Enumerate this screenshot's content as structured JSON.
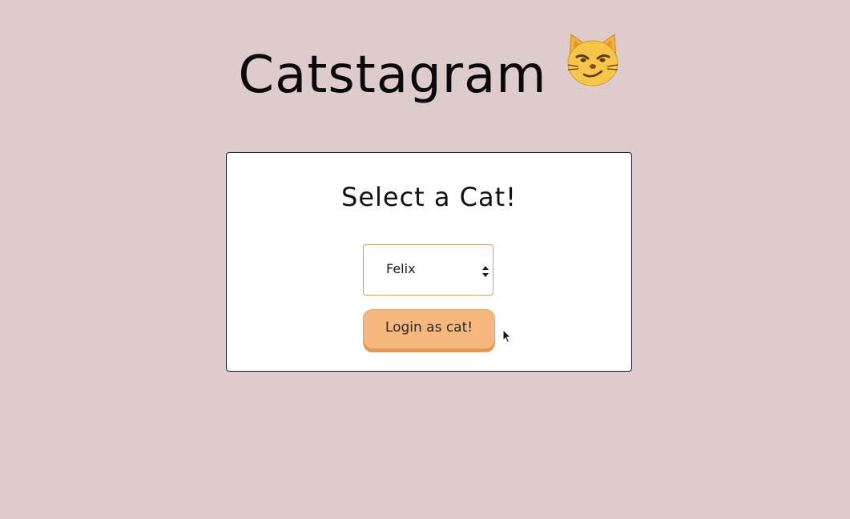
{
  "header": {
    "title": "Catstagram",
    "emoji_icon": "smirking-cat-face-icon"
  },
  "card": {
    "heading": "Select a Cat!",
    "cat_select": {
      "selected_value": "Felix"
    },
    "login_button_label": "Login as cat!"
  },
  "colors": {
    "background": "#decbcb",
    "card_background": "#ffffff",
    "select_border": "#e0a13d",
    "button_fill": "#f6b87c",
    "button_shadow": "#e29a55"
  }
}
